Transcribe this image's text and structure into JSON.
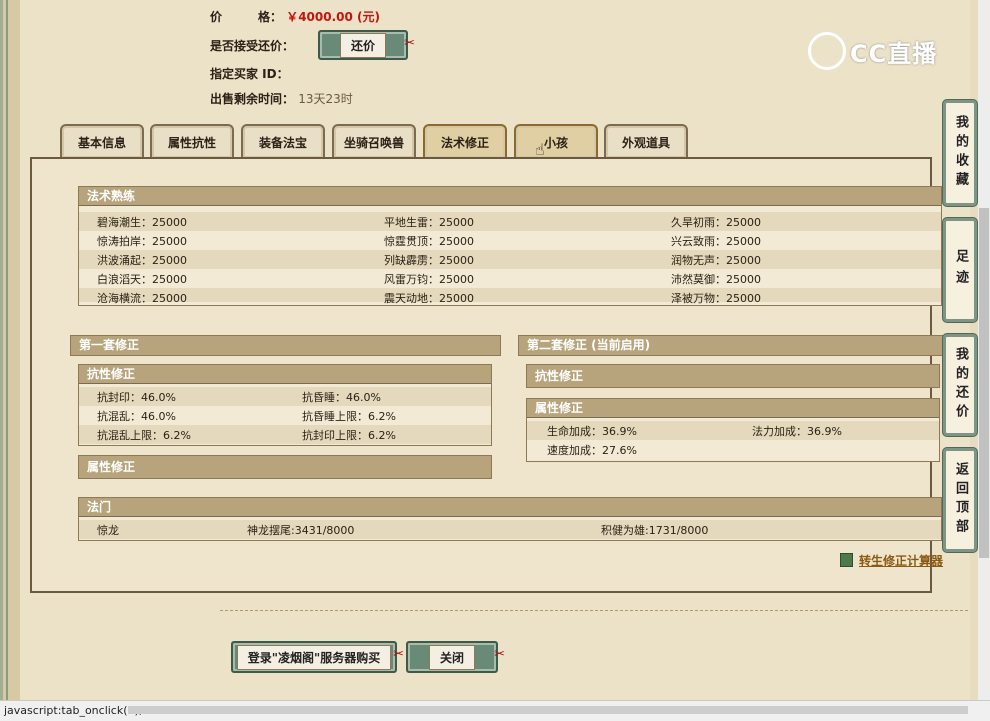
{
  "info": {
    "price_label": "价　　　格：",
    "price_value": "￥4000.00 (元)",
    "bargain_label": "是否接受还价：",
    "bargain_button": "还价",
    "buyer_label": "指定买家 ID：",
    "time_label": "出售剩余时间：",
    "time_value": "13天23时"
  },
  "logo": {
    "text": "CC直播"
  },
  "tabs": [
    "基本信息",
    "属性抗性",
    "装备法宝",
    "坐骑召唤兽",
    "法术修正",
    "小孩",
    "外观道具"
  ],
  "active_tab_index": 4,
  "hovered_tab_index": 5,
  "spell_mastery": {
    "title": "法术熟练",
    "col1": [
      "碧海潮生：25000",
      "惊涛拍岸：25000",
      "洪波涌起：25000",
      "白浪滔天：25000",
      "沧海横流：25000"
    ],
    "col2": [
      "平地生雷：25000",
      "惊霆贯顶：25000",
      "列缺霹雳：25000",
      "风雷万钧：25000",
      "震天动地：25000"
    ],
    "col3": [
      "久旱初雨：25000",
      "兴云致雨：25000",
      "润物无声：25000",
      "沛然莫御：25000",
      "泽被万物：25000"
    ]
  },
  "set1": {
    "title": "第一套修正",
    "resist_title": "抗性修正",
    "resist_rows": [
      [
        "抗封印：46.0%",
        "抗昏睡：46.0%"
      ],
      [
        "抗混乱：46.0%",
        "抗昏睡上限：6.2%"
      ],
      [
        "抗混乱上限：6.2%",
        "抗封印上限：6.2%"
      ]
    ],
    "attr_title": "属性修正"
  },
  "set2": {
    "title": "第二套修正 (当前启用)",
    "resist_title": "抗性修正",
    "attr_title": "属性修正",
    "attr_rows": [
      [
        "生命加成：36.9%",
        "法力加成：36.9%"
      ],
      [
        "速度加成：27.6%",
        ""
      ]
    ]
  },
  "fa_men": {
    "title": "法门",
    "items": [
      "惊龙",
      "神龙摆尾:3431/8000",
      "积健为雄:1731/8000"
    ]
  },
  "calculator_link": "转生修正计算器",
  "buttons": {
    "login_buy": "登录\"凌烟阁\"服务器购买",
    "close": "关闭"
  },
  "sidebar": [
    "我的收藏",
    "足迹",
    "我的还价",
    "返回顶部"
  ],
  "status_bar": "javascript:tab_onclick(6);"
}
